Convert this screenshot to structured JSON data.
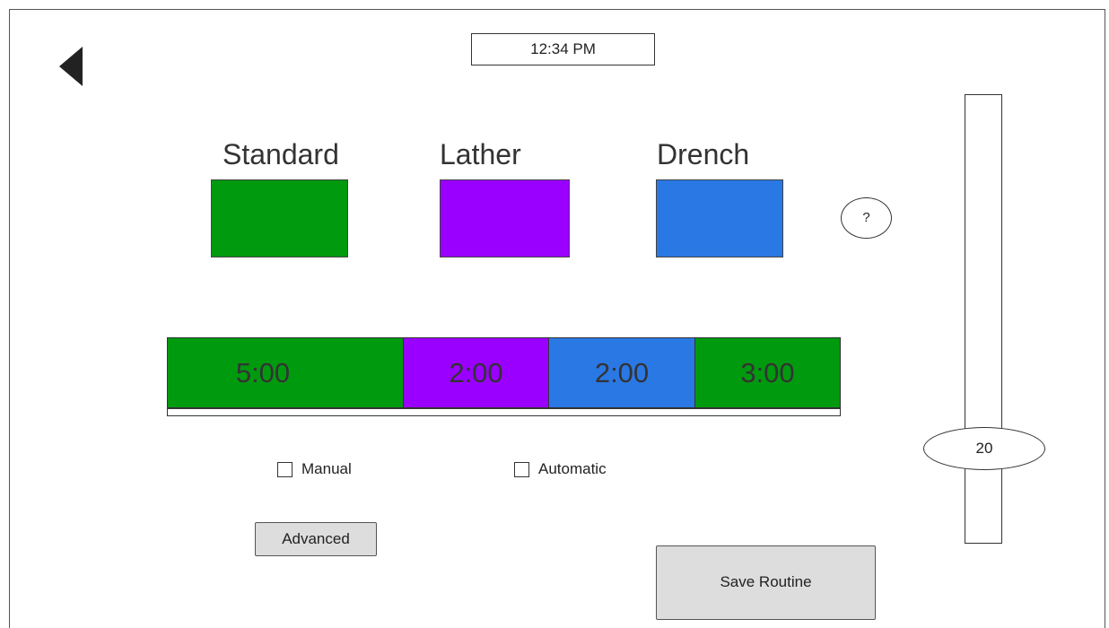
{
  "header": {
    "time": "12:34 PM",
    "back_icon": "back-arrow-icon"
  },
  "modes": [
    {
      "label": "Standard",
      "color": "#009a0e"
    },
    {
      "label": "Lather",
      "color": "#9a00ff"
    },
    {
      "label": "Drench",
      "color": "#2a78e4"
    }
  ],
  "help": {
    "label": "?"
  },
  "timeline": [
    {
      "time": "5:00",
      "mode": "Standard",
      "color": "#009a0e"
    },
    {
      "time": "2:00",
      "mode": "Lather",
      "color": "#9a00ff"
    },
    {
      "time": "2:00",
      "mode": "Drench",
      "color": "#2a78e4"
    },
    {
      "time": "3:00",
      "mode": "Standard",
      "color": "#009a0e"
    }
  ],
  "options": {
    "manual_label": "Manual",
    "automatic_label": "Automatic"
  },
  "buttons": {
    "advanced_label": "Advanced",
    "save_label": "Save Routine"
  },
  "slider": {
    "value": "20"
  }
}
